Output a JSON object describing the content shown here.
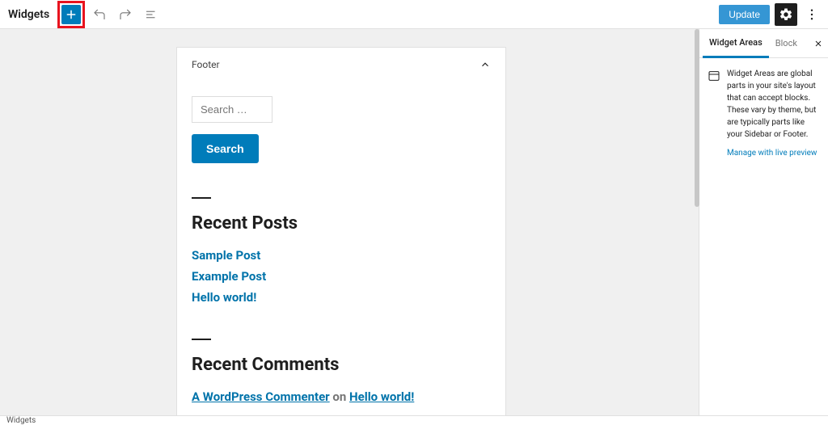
{
  "header": {
    "title": "Widgets",
    "update_label": "Update"
  },
  "panel": {
    "title": "Footer",
    "search_placeholder": "Search …",
    "search_button": "Search",
    "recent_posts_heading": "Recent Posts",
    "posts": [
      "Sample Post",
      "Example Post",
      "Hello world!"
    ],
    "recent_comments_heading": "Recent Comments",
    "comment": {
      "author": "A WordPress Commenter",
      "on": "on",
      "post": "Hello world!"
    }
  },
  "sidebar": {
    "tabs": {
      "areas": "Widget Areas",
      "block": "Block"
    },
    "help_text": "Widget Areas are global parts in your site's layout that can accept blocks. These vary by theme, but are typically parts like your Sidebar or Footer.",
    "preview_link": "Manage with live preview"
  },
  "footer": {
    "breadcrumb": "Widgets"
  }
}
